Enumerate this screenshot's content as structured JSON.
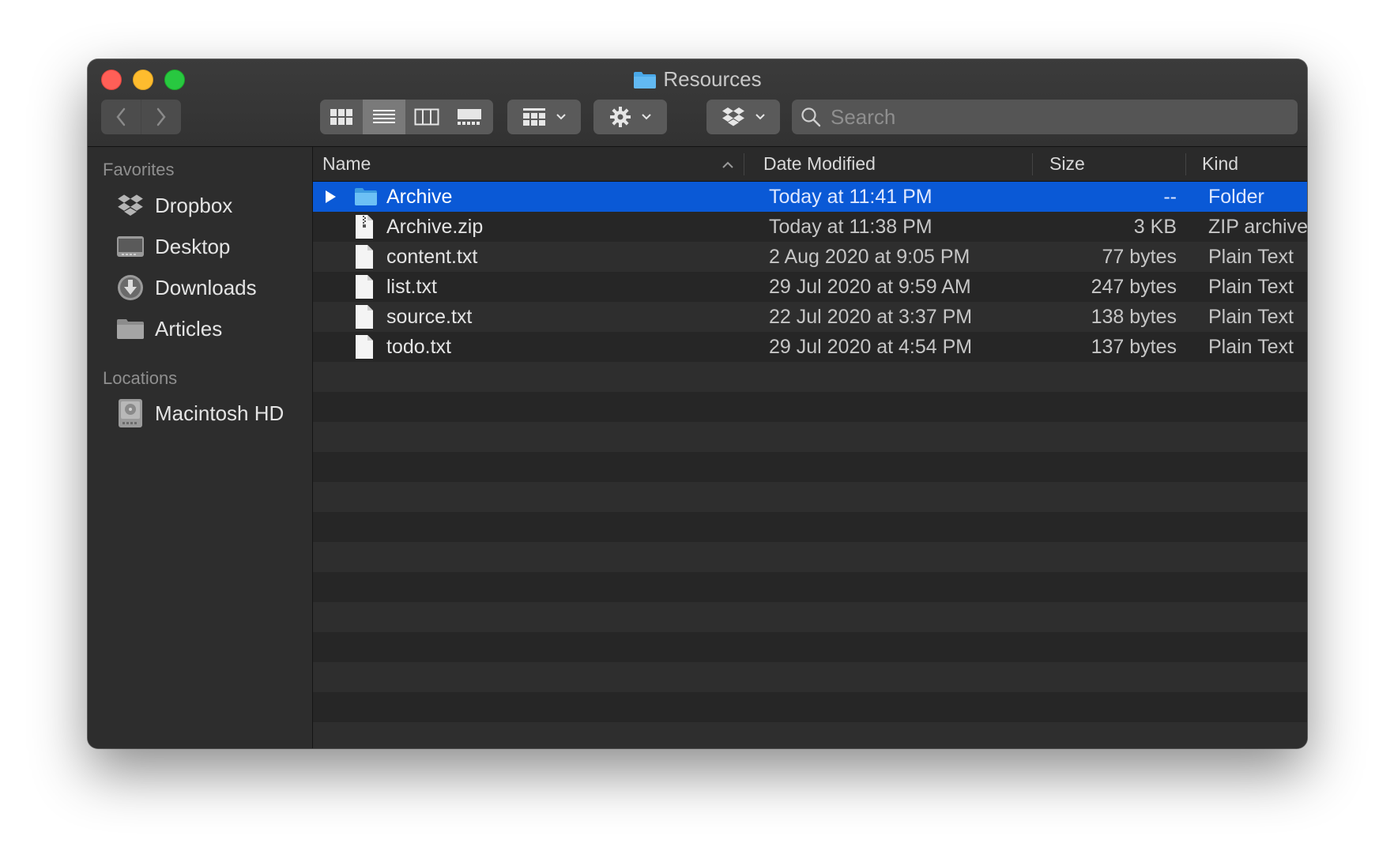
{
  "window": {
    "title": "Resources",
    "title_icon": "folder-icon"
  },
  "toolbar": {
    "back_icon": "chevron-left-icon",
    "forward_icon": "chevron-right-icon",
    "view_modes": [
      "icon-view-icon",
      "list-view-icon",
      "column-view-icon",
      "gallery-view-icon"
    ],
    "active_view": "list-view-icon",
    "arrange_icon": "group-icon",
    "action_icon": "gear-icon",
    "dropbox_icon": "dropbox-icon",
    "search": {
      "placeholder": "Search",
      "value": ""
    }
  },
  "sidebar": {
    "favorites_heading": "Favorites",
    "favorites": [
      {
        "label": "Dropbox",
        "icon": "dropbox-icon"
      },
      {
        "label": "Desktop",
        "icon": "desktop-icon"
      },
      {
        "label": "Downloads",
        "icon": "downloads-icon"
      },
      {
        "label": "Articles",
        "icon": "folder-icon"
      }
    ],
    "locations_heading": "Locations",
    "locations": [
      {
        "label": "Macintosh HD",
        "icon": "hard-drive-icon"
      }
    ]
  },
  "columns": {
    "name": "Name",
    "date": "Date Modified",
    "size": "Size",
    "kind": "Kind"
  },
  "files": [
    {
      "name": "Archive",
      "date": "Today at 11:41 PM",
      "size": "--",
      "kind": "Folder",
      "icon": "folder-icon",
      "selected": true
    },
    {
      "name": "Archive.zip",
      "date": "Today at 11:38 PM",
      "size": "3 KB",
      "kind": "ZIP archive",
      "icon": "zip-file-icon"
    },
    {
      "name": "content.txt",
      "date": "2 Aug 2020 at 9:05 PM",
      "size": "77 bytes",
      "kind": "Plain Text",
      "icon": "document-icon"
    },
    {
      "name": "list.txt",
      "date": "29 Jul 2020 at 9:59 AM",
      "size": "247 bytes",
      "kind": "Plain Text",
      "icon": "document-icon"
    },
    {
      "name": "source.txt",
      "date": "22 Jul 2020 at 3:37 PM",
      "size": "138 bytes",
      "kind": "Plain Text",
      "icon": "document-icon"
    },
    {
      "name": "todo.txt",
      "date": "29 Jul 2020 at 4:54 PM",
      "size": "137 bytes",
      "kind": "Plain Text",
      "icon": "document-icon"
    }
  ],
  "colors": {
    "selection": "#0a59d6",
    "close": "#ff5f57",
    "minimize": "#febc2e",
    "maximize": "#28c840"
  }
}
